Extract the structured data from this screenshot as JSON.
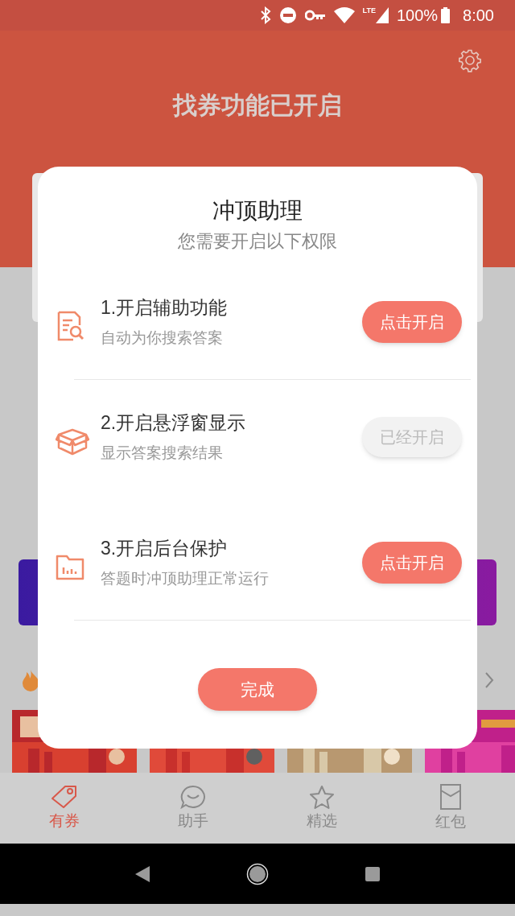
{
  "status_bar": {
    "network": "LTE",
    "battery": "100%",
    "time": "8:00"
  },
  "header": {
    "title": "找券功能已开启"
  },
  "dialog": {
    "title": "冲顶助理",
    "subtitle": "您需要开启以下权限",
    "permissions": [
      {
        "title": "1.开启辅助功能",
        "description": "自动为你搜索答案",
        "button": "点击开启",
        "enabled": false
      },
      {
        "title": "2.开启悬浮窗显示",
        "description": "显示答案搜索结果",
        "button": "已经开启",
        "enabled": true
      },
      {
        "title": "3.开启后台保护",
        "description": "答题时冲顶助理正常运行",
        "button": "点击开启",
        "enabled": false
      }
    ],
    "done_button": "完成"
  },
  "bottom_nav": [
    {
      "label": "有券",
      "selected": true
    },
    {
      "label": "助手",
      "selected": false
    },
    {
      "label": "精选",
      "selected": false
    },
    {
      "label": "红包",
      "selected": false
    }
  ]
}
